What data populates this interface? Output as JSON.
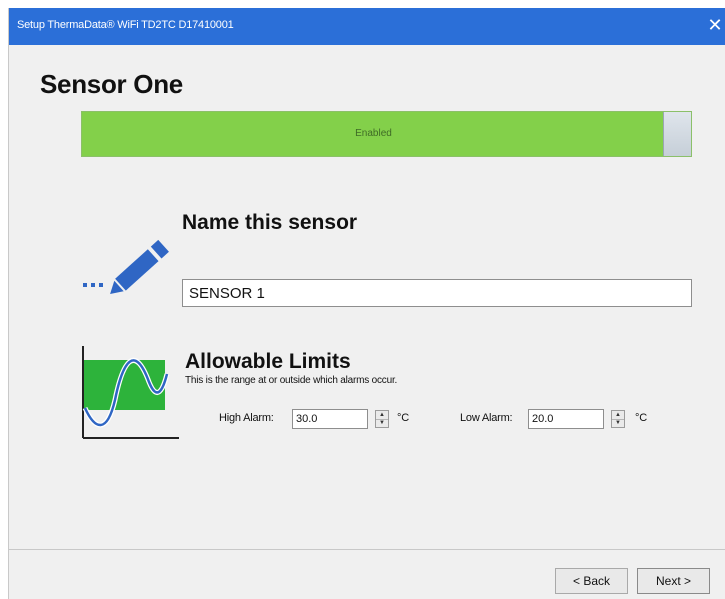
{
  "window": {
    "title": "Setup ThermaData® WiFi TD2TC D17410001",
    "close_glyph": "✕"
  },
  "page": {
    "title": "Sensor One"
  },
  "enable_toggle": {
    "label": "Enabled",
    "color": "#83d04a"
  },
  "name_section": {
    "heading": "Name this sensor",
    "icon": "pencil-icon",
    "input_value": "SENSOR 1"
  },
  "limits_section": {
    "heading": "Allowable Limits",
    "description": "This is the range at or outside which alarms occur.",
    "icon": "sine-wave-limits-icon",
    "high_alarm": {
      "label": "High Alarm:",
      "value": "30.0",
      "unit": "°C"
    },
    "low_alarm": {
      "label": "Low Alarm:",
      "value": "20.0",
      "unit": "°C"
    }
  },
  "footer": {
    "back_label": "< Back",
    "next_label": "Next >"
  },
  "colors": {
    "titlebar": "#2b6fd8",
    "accent_blue": "#2f66c4",
    "limits_green": "#2db33b"
  }
}
